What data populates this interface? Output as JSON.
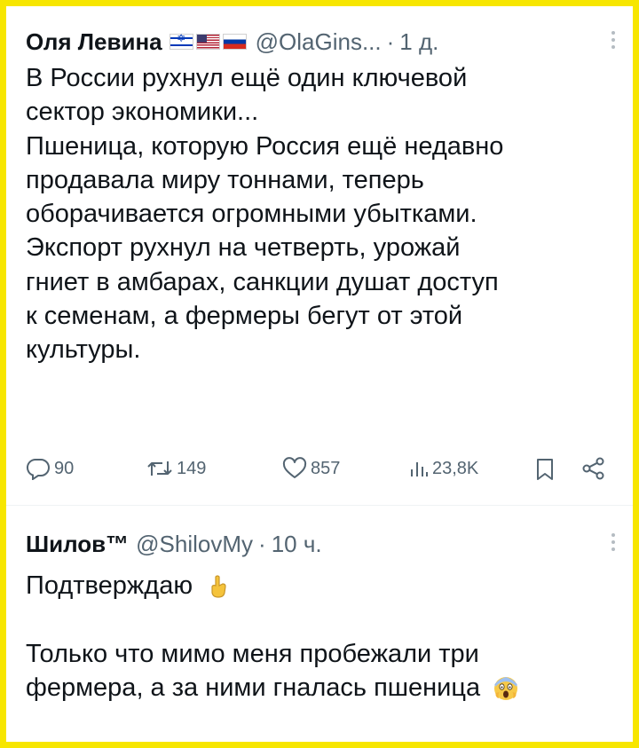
{
  "tweet1": {
    "author_name": "Оля Левина",
    "flags": [
      "israel-flag",
      "usa-flag",
      "russia-flag"
    ],
    "handle": "@OlaGins...",
    "separator": "·",
    "time": "1 д.",
    "lines": [
      "В России рухнул ещё один ключевой",
      "сектор экономики...",
      "Пшеница, которую Россия ещё недавно",
      "продавала миру тоннами, теперь",
      "оборачивается огромными убытками.",
      "Экспорт рухнул на четверть, урожай",
      "гниет в амбарах, санкции душат доступ",
      "к семенам, а фермеры бегут от этой",
      "культуры."
    ],
    "actions": {
      "replies": "90",
      "reposts": "149",
      "likes": "857",
      "views": "23,8K"
    }
  },
  "tweet2": {
    "author_name": "Шилов™",
    "handle": "@ShilovMy",
    "separator": "·",
    "time": "10 ч.",
    "line1": "Подтверждаю",
    "line1_emoji": "hand-with-index-finger-up-emoji",
    "line2": "Только что мимо меня пробежали три",
    "line3": "фермера, а за ними гналась пшеница",
    "line3_emoji": "screaming-face-emoji"
  },
  "colors": {
    "frame": "#f7e600",
    "text": "#0f1419",
    "muted": "#536471"
  }
}
